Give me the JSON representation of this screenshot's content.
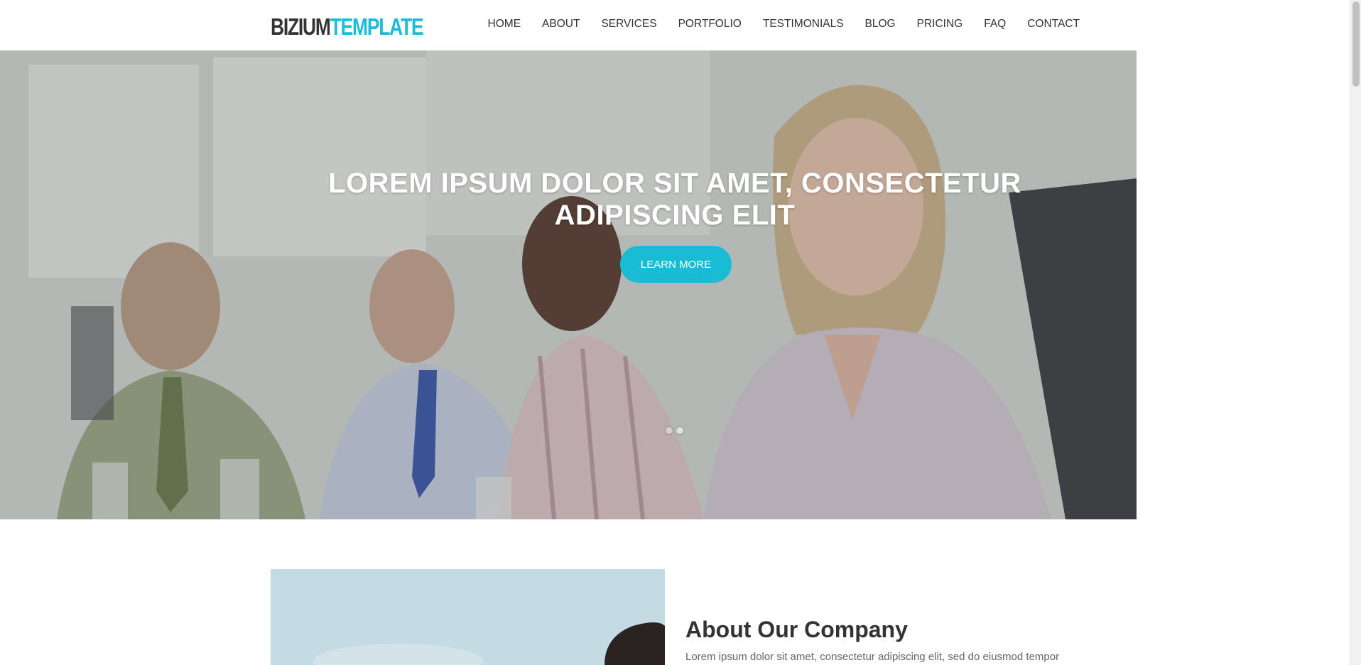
{
  "brand": {
    "logo_part1": "BIZIUM",
    "logo_part2": "TEMPLATE",
    "accent_color": "#1bbcd7"
  },
  "nav": {
    "items": [
      {
        "label": "HOME"
      },
      {
        "label": "ABOUT"
      },
      {
        "label": "SERVICES"
      },
      {
        "label": "PORTFOLIO"
      },
      {
        "label": "TESTIMONIALS"
      },
      {
        "label": "BLOG"
      },
      {
        "label": "PRICING"
      },
      {
        "label": "FAQ"
      },
      {
        "label": "CONTACT"
      }
    ]
  },
  "hero": {
    "title_line1": "LOREM IPSUM DOLOR SIT AMET, CONSECTETUR",
    "title_line2": "ADIPISCING ELIT",
    "button_label": "LEARN MORE",
    "button_color": "#19bbd5",
    "slide_count": 2,
    "active_slide": 1
  },
  "about": {
    "title": "About Our Company",
    "text": "Lorem ipsum dolor sit amet, consectetur adipiscing elit, sed do eiusmod tempor"
  }
}
